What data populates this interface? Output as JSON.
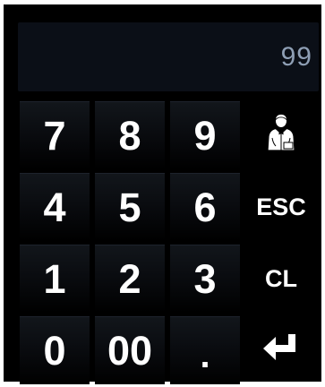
{
  "display": {
    "value": "99"
  },
  "keys": {
    "seven": "7",
    "eight": "8",
    "nine": "9",
    "four": "4",
    "five": "5",
    "six": "6",
    "one": "1",
    "two": "2",
    "three": "3",
    "zero": "0",
    "double_zero": "00",
    "decimal": "."
  },
  "functions": {
    "escape": "ESC",
    "clear": "CL",
    "waiter_icon": "waiter-icon",
    "enter_icon": "enter-arrow-icon"
  },
  "colors": {
    "background": "#000000",
    "display_background": "#0b0f17",
    "display_text": "#8f9fb5",
    "key_text": "#ffffff"
  }
}
